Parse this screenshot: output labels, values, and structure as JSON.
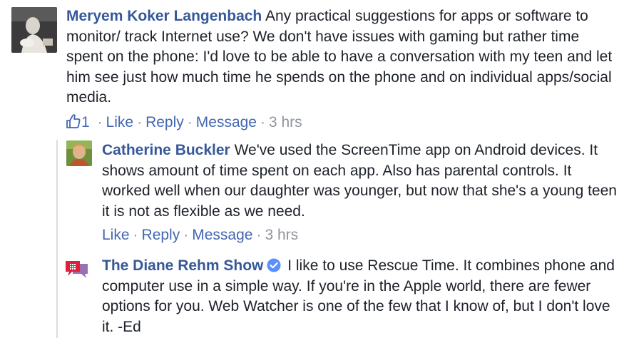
{
  "comments": [
    {
      "author": "Meryem Koker Langenbach",
      "text": "Any practical suggestions for apps or software to monitor/ track Internet use? We don't have issues with gaming but rather time spent on the phone: I'd love to be able to have a conversation with my teen and let him see just how much time he spends on the phone and on individual apps/social media.",
      "like_count": "1",
      "like_label": "Like",
      "reply_label": "Reply",
      "message_label": "Message",
      "time": "3 hrs",
      "avatar_icon": "user-photo"
    }
  ],
  "replies": [
    {
      "author": "Catherine Buckler",
      "text": "We've used the ScreenTime app on Android devices. It shows amount of time spent on each app. Also has parental controls. It worked well when our daughter was younger, but now that she's a young teen it is not as flexible as we need.",
      "like_label": "Like",
      "reply_label": "Reply",
      "message_label": "Message",
      "time": "3 hrs",
      "avatar_icon": "user-photo"
    },
    {
      "author": "The Diane Rehm Show",
      "verified": true,
      "text": "I like to use Rescue Time. It combines phone and computer use in a simple way. If you're in the Apple world, there are fewer options for you. Web Watcher is one of the few that I know of, but I don't love it. -Ed",
      "avatar_icon": "speech-bubbles-logo"
    }
  ],
  "separator": "·",
  "colors": {
    "author": "#365899",
    "link": "#4267b2",
    "meta": "#90949c",
    "text": "#1d2129",
    "verified": "#5890ff"
  }
}
